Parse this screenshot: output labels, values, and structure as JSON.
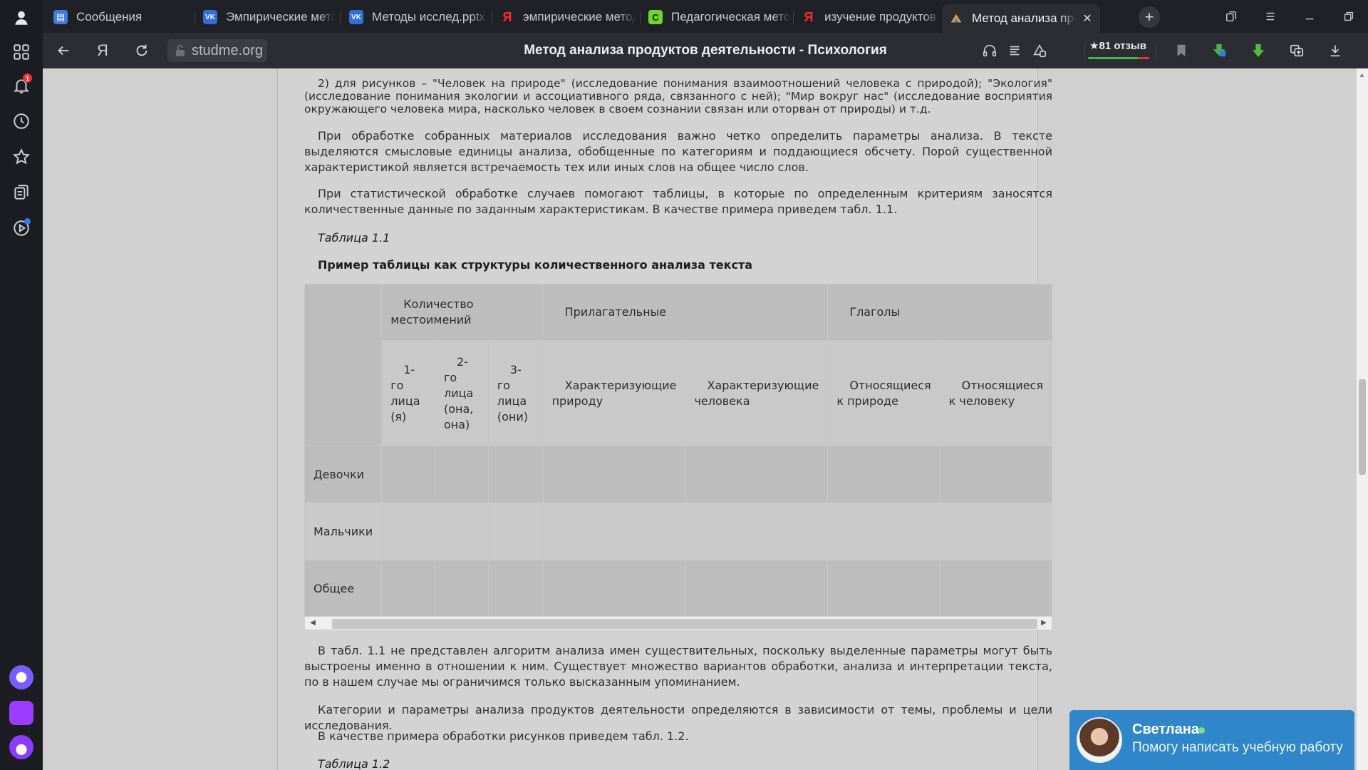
{
  "sidebar": {
    "notification_count": "1",
    "items": [
      {
        "name": "profile-icon"
      },
      {
        "name": "apps-grid-icon"
      },
      {
        "name": "bell-icon"
      },
      {
        "name": "history-icon"
      },
      {
        "name": "star-icon"
      },
      {
        "name": "collections-icon"
      },
      {
        "name": "play-icon"
      }
    ]
  },
  "tabs": [
    {
      "label": "Сообщения",
      "icon": "messages-icon",
      "color": "#3d7be0",
      "glyph": "▤"
    },
    {
      "label": "Эмпирические методы",
      "icon": "vk-icon",
      "color": "#2f6fd6",
      "glyph": "VK"
    },
    {
      "label": "Методы исслед.pptx",
      "icon": "vk-icon",
      "color": "#2f6fd6",
      "glyph": "VK"
    },
    {
      "label": "эмпирические методы",
      "icon": "yandex-icon",
      "color": "#ff2a2a",
      "glyph": "Я"
    },
    {
      "label": "Педагогическая методика",
      "icon": "site-c-icon",
      "color": "#6fd42e",
      "glyph": "C"
    },
    {
      "label": "изучение продуктов",
      "icon": "yandex-icon",
      "color": "#ff2a2a",
      "glyph": "Я"
    },
    {
      "label": "Метод анализа продуктов",
      "icon": "studme-icon",
      "color": "#2b2d33",
      "glyph": "▲",
      "active": true
    }
  ],
  "toolbar": {
    "url": "studme.org",
    "page_title": "Метод анализа продуктов деятельности - Психология",
    "rating_label": "★81 отзыв"
  },
  "article": {
    "p1": "2) для рисунков – \"Человек на природе\" (исследование понимания взаимоотношений человека с природой); \"Экология\" (исследование понимания экологии и ассоциативного ряда, связанного с ней); \"Мир вокруг нас\" (исследование восприятия окружающего человека мира, насколько человек в своем сознании связан или оторван от природы) и т.д.",
    "p2": "При обработке собранных материалов исследования важно четко определить параметры анализа. В тексте выделяются смысловые единицы анализа, обобщенные по категориям и поддающиеся обсчету. Порой существенной характеристикой является встречаемость тех или иных слов на общее число слов.",
    "p3": "При статистической обработке случаев помогают таблицы, в которые по определенным критериям заносятся количественные данные по заданным характеристикам. В качестве примера приведем табл. 1.1.",
    "table_caption": "Таблица 1.1",
    "table_title": "Пример таблицы как структуры количественного анализа текста",
    "table": {
      "group_headers": [
        "Количество местоимений",
        "Прилагательные",
        "Глаголы"
      ],
      "sub_headers": [
        "1-го лица (я)",
        "2-го лица (она, она)",
        "3-го лица (они)",
        "Характеризующие природу",
        "Характеризующие человека",
        "Относящиеся к природе",
        "Относящиеся к человеку"
      ],
      "rows": [
        "Девочки",
        "Мальчики",
        "Общее"
      ]
    },
    "p4": "В табл. 1.1 не представлен алгоритм анализа имен существительных, поскольку выделенные параметры могут быть выстроены именно в отношении к ним. Существует множество вариантов обработки, анализа и интерпретации текста, по в нашем случае мы ограничимся только высказанным упоминанием.",
    "p5": "Категории и параметры анализа продуктов деятельности определяются в зависимости от темы, проблемы и цели исследования.",
    "p6": "В качестве примера обработки рисунков приведем табл. 1.2.",
    "table2_caption": "Таблица 1.2"
  },
  "chat": {
    "name": "Светлана",
    "message": "Помогу написать учебную работу"
  }
}
